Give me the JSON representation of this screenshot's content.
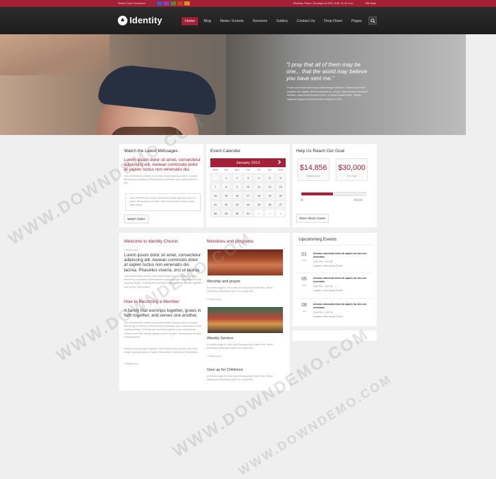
{
  "topbar": {
    "color_label": "Select Color Schemes:",
    "swatches": [
      "#3b5bc2",
      "#8e3fb0",
      "#4e8b3a",
      "#c8421c",
      "#d98c2a"
    ],
    "hours": "Worship Times: Sundays at 9:00, 9:45, 11:00 a.m.",
    "sitemap": "Site Map"
  },
  "brand": {
    "name": "Identity",
    "mark": "♠"
  },
  "nav": [
    {
      "label": "Home",
      "active": true
    },
    {
      "label": "Blog"
    },
    {
      "label": "News / Events"
    },
    {
      "label": "Sermons"
    },
    {
      "label": "Gallery"
    },
    {
      "label": "Contact Us"
    },
    {
      "label": "Drop Down"
    },
    {
      "label": "Pages"
    }
  ],
  "search_icon": "search-icon",
  "hero": {
    "quote": "\"I pray that all of them may be one... that the world may believe you have sent me.\"",
    "sub": "Fusce accumsan sed lacus pellentesque eleifend. Donec lacus nibh, sodales vel, sapien ultrices placerat ac, neque. Nam semper hendrerit facilisis, nulla lacus tincidunt dolor, a viverra metus tortor. Integer dapibus magna in elit fermentum aliquam in elit."
  },
  "messages": {
    "title": "Watch the Latest Messages",
    "lead": "Lorem ipsum dolor sit amet, consectetur adipiscing elit. Aenean commodo dolor at sapien luctus non venenatis dui.",
    "body": "Your membership means more than simply signing a piece of paper. Becoming a member of Benedictine expresses your commitment to live.",
    "quote": "Your membership means more than simply signing a piece of paper. Becoming a member Your membership means more than simply.",
    "button": "Watch Video"
  },
  "calendar": {
    "title": "Event Calender",
    "month": "January 2012",
    "next_icon": "chevron-right-icon",
    "weekdays": [
      "MON",
      "TUE",
      "WED",
      "THU",
      "FRI",
      "SAT",
      "SUN"
    ],
    "days": [
      "",
      "1",
      "2",
      "3",
      "4",
      "5",
      "6",
      "7",
      "8",
      "9",
      "10",
      "11",
      "12",
      "13",
      "14",
      "15",
      "16",
      "17",
      "18",
      "19",
      "20",
      "21",
      "22",
      "23",
      "24",
      "25",
      "26",
      "27",
      "28",
      "29",
      "30",
      "31",
      "1",
      "2",
      "3"
    ]
  },
  "goal": {
    "title": "Help Us Reach Our Goal",
    "raised": "$14,856",
    "raised_caption": "Raised so far",
    "target": "$30,000",
    "target_caption": "Our Goal",
    "progress": 0.4952,
    "min_label": "$0",
    "max_label": "$30,000",
    "button": "More About Cause"
  },
  "welcome": {
    "title": "Welcome to Identity Church",
    "read_more_top": "» Read more",
    "lead": "Lorem ipsum dolor sit amet, consectetur adipiscing elit. Aenean commodo dolor at sapien luctus non venenatis dui lacinia. Phasellus viverra, orci ut lacinia.",
    "body": "Your membership means more than simply signing a piece of paper. Becoming a member of Benedictine expresses your commitment to live \"spiritual family.\" A family that worships together, grows in faith together, and serves one another.",
    "sub_title": "How to Becoming a Member",
    "sub_lead": "A family that worships together, grows in faith together, and serves one another.",
    "sub_body": "Your membership means more than simply signing a piece of paper. Becoming a member of Benedictine expresses your commitment to live \"spiritual family.\" A family that worships together your membership means more than simply signing a piece of paper. Becoming a member of Benedictine.",
    "sub_body2": "A family that worships together Your membership means more than simply signing a piece of paper. Becoming a member of Benedictine.",
    "read_more": "» Read more"
  },
  "ministries": {
    "title": "Ministries and programs",
    "items": [
      {
        "title": "Worship and prayer",
        "text": "A historic judge in Ohio ruled Monday that Amish Rep. Steve Dickerson defamation suit is in a case that",
        "more": "» Read more"
      },
      {
        "title": "Weekly Service",
        "text": "A historic judge in Ohio ruled Monday that Amish Rep. Steve Dickerson defamation suit is in a case that",
        "more": "» Read more"
      },
      {
        "title": "Give up for Childrens",
        "text": "A historic judge in Ohio ruled Monday that Amish Rep. Steve Dickerson defamation suit is in a case that",
        "more": ""
      }
    ]
  },
  "events": {
    "title": "Upcomming Events",
    "items": [
      {
        "day": "01",
        "month": "JAN",
        "title": "Aenean commodo dolor at sapien luc tus non venenatis",
        "time": "10:00 PM - 1:00 PM",
        "location": "Location: Lorem ipsum Church"
      },
      {
        "day": "05",
        "month": "JAN",
        "title": "Aenean commodo dolor at sapien luc tus non venenatis",
        "time": "10:00 PM - 1:00 PM",
        "location": "Location: Lorem ipsum Church"
      },
      {
        "day": "08",
        "month": "JAN",
        "title": "Aenean commodo dolor at sapien luc tus non venenatis",
        "time": "10:00 PM - 1:00 PM",
        "location": "Location: Lorem ipsum Church"
      }
    ]
  },
  "watermark": "WWW.DOWNDEMO.COM"
}
